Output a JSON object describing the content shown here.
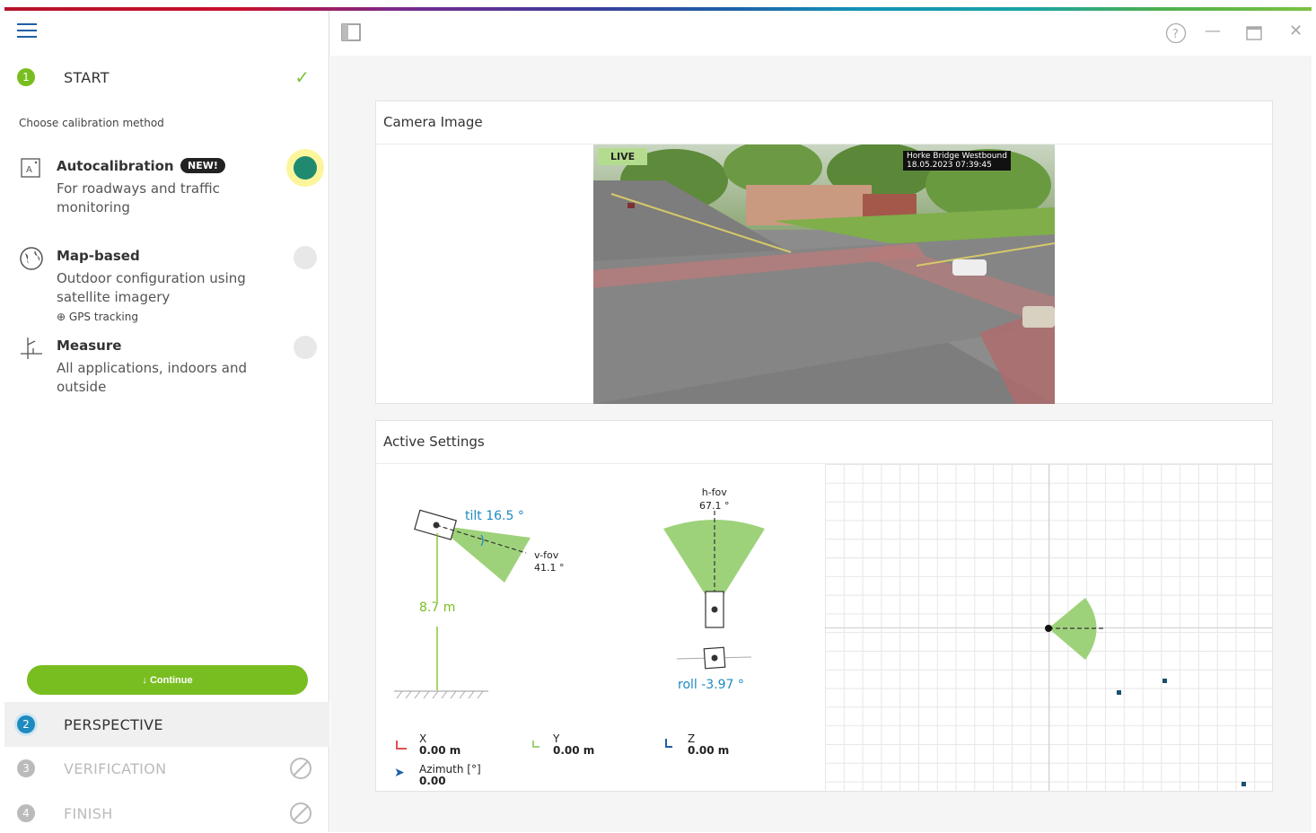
{
  "steps": [
    {
      "num": "1",
      "label": "START",
      "color": "#78be20"
    },
    {
      "num": "2",
      "label": "PERSPECTIVE",
      "color": "#1f8ac0"
    },
    {
      "num": "3",
      "label": "VERIFICATION",
      "color": "#bbbbbb"
    },
    {
      "num": "4",
      "label": "FINISH",
      "color": "#bbbbbb"
    }
  ],
  "choose_label": "Choose calibration method",
  "methods": [
    {
      "title": "Autocalibration",
      "badge": "NEW!",
      "desc": "For roadways and traffic monitoring",
      "selected": true
    },
    {
      "title": "Map-based",
      "desc": "Outdoor configuration using satellite imagery",
      "sub": "GPS tracking",
      "selected": false
    },
    {
      "title": "Measure",
      "desc": "All applications, indoors and outside",
      "selected": false
    }
  ],
  "continue_label": "↓ Continue",
  "camera_card": {
    "title": "Camera Image",
    "live_label": "LIVE",
    "overlay_name": "Horke Bridge Westbound",
    "overlay_time": "18.05.2023 07:39:45"
  },
  "settings_card": {
    "title": "Active Settings",
    "tilt": "tilt 16.5 °",
    "vfov_label": "v-fov",
    "vfov_value": "41.1 °",
    "height": "8.7 m",
    "hfov_label": "h-fov",
    "hfov_value": "67.1 °",
    "roll": "roll -3.97 °",
    "x_label": "X",
    "x_value": "0.00 m",
    "y_label": "Y",
    "y_value": "0.00 m",
    "z_label": "Z",
    "z_value": "0.00 m",
    "azimuth_label": "Azimuth [°]",
    "azimuth_value": "0.00"
  },
  "colors": {
    "accent": "#78be20",
    "fov": "#9ed27a",
    "blue": "#1f8ac0"
  }
}
